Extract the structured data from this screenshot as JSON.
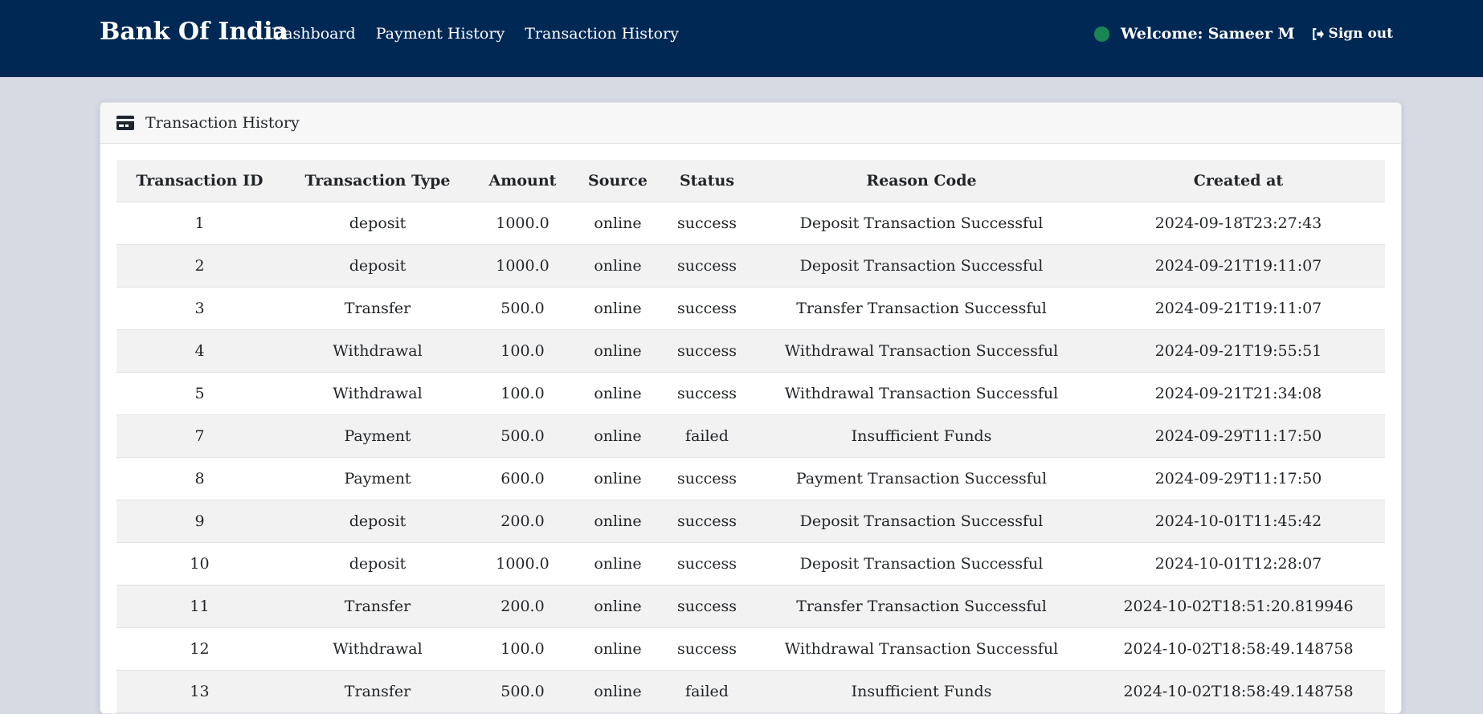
{
  "navbar": {
    "brand": "Bank Of India",
    "links": [
      "Dashboard",
      "Payment History",
      "Transaction History"
    ],
    "welcome_label": "Welcome:",
    "user_name": "Sameer M",
    "signout_label": "Sign out",
    "status_color": "#198754",
    "background": "#002855"
  },
  "card": {
    "title": "Transaction History",
    "icon": "credit-card-icon"
  },
  "table": {
    "columns": [
      "Transaction ID",
      "Transaction Type",
      "Amount",
      "Source",
      "Status",
      "Reason Code",
      "Created at"
    ],
    "rows": [
      [
        "1",
        "deposit",
        "1000.0",
        "online",
        "success",
        "Deposit Transaction Successful",
        "2024-09-18T23:27:43"
      ],
      [
        "2",
        "deposit",
        "1000.0",
        "online",
        "success",
        "Deposit Transaction Successful",
        "2024-09-21T19:11:07"
      ],
      [
        "3",
        "Transfer",
        "500.0",
        "online",
        "success",
        "Transfer Transaction Successful",
        "2024-09-21T19:11:07"
      ],
      [
        "4",
        "Withdrawal",
        "100.0",
        "online",
        "success",
        "Withdrawal Transaction Successful",
        "2024-09-21T19:55:51"
      ],
      [
        "5",
        "Withdrawal",
        "100.0",
        "online",
        "success",
        "Withdrawal Transaction Successful",
        "2024-09-21T21:34:08"
      ],
      [
        "7",
        "Payment",
        "500.0",
        "online",
        "failed",
        "Insufficient Funds",
        "2024-09-29T11:17:50"
      ],
      [
        "8",
        "Payment",
        "600.0",
        "online",
        "success",
        "Payment Transaction Successful",
        "2024-09-29T11:17:50"
      ],
      [
        "9",
        "deposit",
        "200.0",
        "online",
        "success",
        "Deposit Transaction Successful",
        "2024-10-01T11:45:42"
      ],
      [
        "10",
        "deposit",
        "1000.0",
        "online",
        "success",
        "Deposit Transaction Successful",
        "2024-10-01T12:28:07"
      ],
      [
        "11",
        "Transfer",
        "200.0",
        "online",
        "success",
        "Transfer Transaction Successful",
        "2024-10-02T18:51:20.819946"
      ],
      [
        "12",
        "Withdrawal",
        "100.0",
        "online",
        "success",
        "Withdrawal Transaction Successful",
        "2024-10-02T18:58:49.148758"
      ],
      [
        "13",
        "Transfer",
        "500.0",
        "online",
        "failed",
        "Insufficient Funds",
        "2024-10-02T18:58:49.148758"
      ]
    ]
  }
}
